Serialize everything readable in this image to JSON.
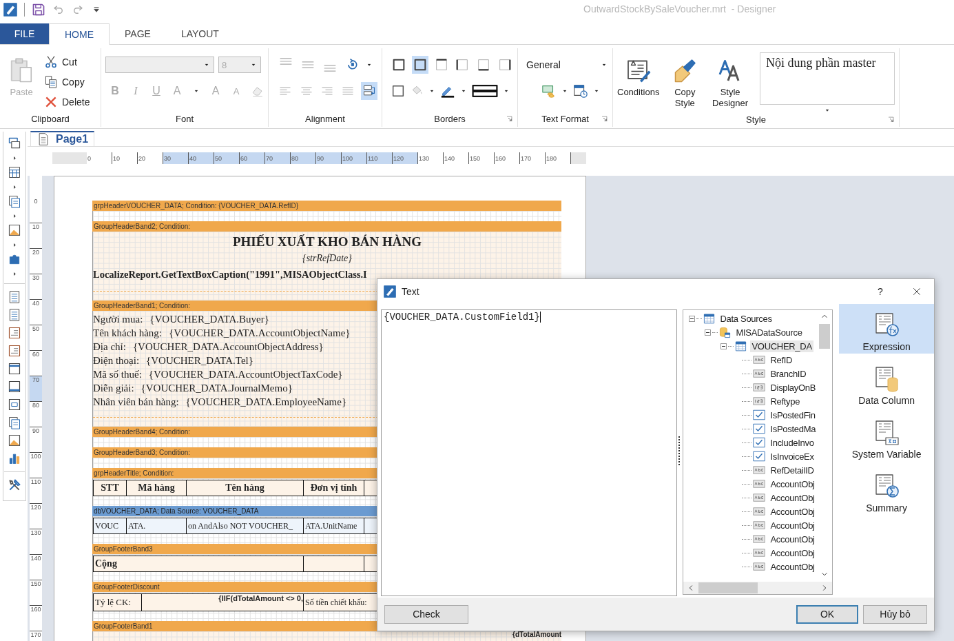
{
  "window": {
    "title": "OutwardStockBySaleVoucher.mrt  - Designer"
  },
  "ribbon": {
    "tabs": [
      {
        "label": "FILE",
        "kind": "file",
        "selected": false
      },
      {
        "label": "HOME",
        "kind": "tab",
        "selected": true
      },
      {
        "label": "PAGE",
        "kind": "tab",
        "selected": false
      },
      {
        "label": "LAYOUT",
        "kind": "tab",
        "selected": false
      }
    ],
    "clipboard": {
      "label": "Clipboard",
      "paste": {
        "label": "Paste",
        "disabled": true
      },
      "actions": [
        {
          "label": "Cut",
          "kind": "cut"
        },
        {
          "label": "Copy",
          "kind": "copy"
        },
        {
          "label": "Delete",
          "kind": "delete"
        }
      ]
    },
    "font": {
      "label": "Font",
      "disabled": true,
      "size": "8",
      "styles": [
        {
          "label": "B",
          "kind": "bold"
        },
        {
          "label": "I",
          "kind": "italic"
        },
        {
          "label": "U",
          "kind": "underline"
        },
        {
          "label": "A",
          "kind": "color"
        },
        {
          "label": "A",
          "kind": "grow"
        },
        {
          "label": "A",
          "kind": "shrink"
        }
      ]
    },
    "alignment": {
      "label": "Alignment",
      "buttons": [
        {
          "kind": "align-top",
          "on": false
        },
        {
          "kind": "align-middle",
          "on": false
        },
        {
          "kind": "align-bottom",
          "on": false
        },
        {
          "kind": "rotate",
          "on": false
        },
        {
          "kind": "align-left",
          "on": false
        },
        {
          "kind": "align-center",
          "on": false
        },
        {
          "kind": "align-right",
          "on": false
        },
        {
          "kind": "justify",
          "on": false
        },
        {
          "kind": "wrap",
          "on": true
        }
      ]
    },
    "borders": {
      "label": "Borders",
      "buttons": [
        {
          "kind": "border-all",
          "on": false
        },
        {
          "kind": "border-none",
          "on": true
        },
        {
          "kind": "border-top",
          "on": false
        },
        {
          "kind": "border-left",
          "on": false
        },
        {
          "kind": "border-bottom",
          "on": false
        },
        {
          "kind": "border-right",
          "on": false
        }
      ]
    },
    "text_format": {
      "label": "Text Format",
      "format": "General"
    },
    "style": {
      "label": "Style",
      "buttons": [
        {
          "label": "Conditions",
          "kind": "conditions"
        },
        {
          "label": "Copy Style",
          "kind": "copy-style"
        },
        {
          "label": "Style Designer",
          "kind": "style-designer"
        }
      ],
      "gallery": "Nội dung phần master"
    }
  },
  "document_tabs": [
    {
      "label": "Page1",
      "selected": true
    }
  ],
  "ruler": {
    "horizontal": [
      {
        "label": "0",
        "selected": false
      },
      {
        "label": "10",
        "selected": false
      },
      {
        "label": "20",
        "selected": false
      },
      {
        "label": "30",
        "selected": true
      },
      {
        "label": "40",
        "selected": true
      },
      {
        "label": "50",
        "selected": true
      },
      {
        "label": "60",
        "selected": true
      },
      {
        "label": "70",
        "selected": true
      },
      {
        "label": "80",
        "selected": true
      },
      {
        "label": "90",
        "selected": true
      },
      {
        "label": "100",
        "selected": true
      },
      {
        "label": "110",
        "selected": true
      },
      {
        "label": "120",
        "selected": true
      },
      {
        "label": "130",
        "selected": false
      },
      {
        "label": "140",
        "selected": false
      },
      {
        "label": "150",
        "selected": false
      },
      {
        "label": "160",
        "selected": false
      },
      {
        "label": "170",
        "selected": false
      },
      {
        "label": "180",
        "selected": false
      }
    ],
    "vertical": [
      {
        "label": "0",
        "selected": false
      },
      {
        "label": "10",
        "selected": false
      },
      {
        "label": "20",
        "selected": false
      },
      {
        "label": "30",
        "selected": false
      },
      {
        "label": "40",
        "selected": false
      },
      {
        "label": "50",
        "selected": false
      },
      {
        "label": "60",
        "selected": false
      },
      {
        "label": "70",
        "selected": true
      },
      {
        "label": "80",
        "selected": false
      },
      {
        "label": "90",
        "selected": false
      },
      {
        "label": "100",
        "selected": false
      },
      {
        "label": "110",
        "selected": false
      },
      {
        "label": "120",
        "selected": false
      },
      {
        "label": "130",
        "selected": false
      },
      {
        "label": "140",
        "selected": false
      },
      {
        "label": "150",
        "selected": false
      },
      {
        "label": "160",
        "selected": false
      },
      {
        "label": "170",
        "selected": false
      }
    ]
  },
  "report": {
    "bands": [
      {
        "caption": "grpHeaderVOUCHER_DATA; Condition: {VOUCHER_DATA.RefID}",
        "kind": "group",
        "content": {
          "kind": "empty"
        }
      },
      {
        "caption": "GroupHeaderBand2; Condition:",
        "kind": "group",
        "content": {
          "kind": "title",
          "title": "PHIẾU XUẤT KHO BÁN HÀNG",
          "subtitle": "{strRefDate}",
          "caption_line": "LocalizeReport.GetTextBoxCaption(\"1991\",MISAObjectClass.I"
        }
      },
      {
        "caption": "GroupHeaderBand1; Condition:",
        "kind": "group",
        "content": {
          "kind": "fields",
          "rows": [
            {
              "label": "Người mua:",
              "value": "{VOUCHER_DATA.Buyer}"
            },
            {
              "label": "Tên khách hàng:",
              "value": "{VOUCHER_DATA.AccountObjectName}"
            },
            {
              "label": "Địa chỉ:",
              "value": "{VOUCHER_DATA.AccountObjectAddress}"
            },
            {
              "label": "Điện thoại:",
              "value": "{VOUCHER_DATA.Tel}"
            },
            {
              "label": "Mã số thuế:",
              "value": "{VOUCHER_DATA.AccountObjectTaxCode}"
            },
            {
              "label": "Diễn giải:",
              "value": "{VOUCHER_DATA.JournalMemo}"
            },
            {
              "label": "Nhân viên bán hàng:",
              "value": "{VOUCHER_DATA.EmployeeName}"
            }
          ]
        }
      },
      {
        "caption": "GroupHeaderBand4; Condition:",
        "kind": "group",
        "content": {
          "kind": "empty"
        }
      },
      {
        "caption": "GroupHeaderBand3; Condition:",
        "kind": "group",
        "content": {
          "kind": "empty"
        }
      },
      {
        "caption": "grpHeaderTitle; Condition:",
        "kind": "group",
        "content": {
          "kind": "header",
          "cells": [
            "STT",
            "Mã hàng",
            "Tên hàng",
            "Đơn vị tính"
          ]
        }
      },
      {
        "caption": "dbVOUCHER_DATA; Data Source: VOUCHER_DATA",
        "kind": "data",
        "content": {
          "kind": "row",
          "cells": [
            "VOUC",
            "ATA.",
            "on AndAlso NOT VOUCHER_",
            "ATA.UnitName"
          ]
        }
      },
      {
        "caption": "GroupFooterBand3",
        "kind": "group",
        "content": {
          "kind": "total",
          "cells": [
            "Cộng"
          ]
        }
      },
      {
        "caption": "GroupFooterDiscount",
        "kind": "group",
        "content": {
          "kind": "discount",
          "cells": [
            "Tỷ lệ CK:",
            "{IIF(dTotalAmount <> 0,",
            "Số tiền chiết khấu:"
          ]
        }
      },
      {
        "caption": "GroupFooterBand1",
        "kind": "group",
        "content": {
          "kind": "footer",
          "cells": [
            "{dTotalAmount"
          ]
        }
      }
    ]
  },
  "dialog": {
    "title": "Text",
    "help": "?",
    "expression": "{VOUCHER_DATA.CustomField1}",
    "tree": {
      "items": [
        {
          "label": "Data Sources",
          "kind": "sources",
          "expanded": true,
          "selected": false,
          "children": [
            {
              "label": "MISADataSource",
              "kind": "database",
              "expanded": true,
              "selected": false,
              "children": [
                {
                  "label": "VOUCHER_DA",
                  "kind": "table",
                  "expanded": true,
                  "selected": true,
                  "children": [
                    {
                      "label": "RefID",
                      "kind": "text",
                      "selected": false
                    },
                    {
                      "label": "BranchID",
                      "kind": "text",
                      "selected": false
                    },
                    {
                      "label": "DisplayOnB",
                      "kind": "number",
                      "selected": false
                    },
                    {
                      "label": "Reftype",
                      "kind": "number",
                      "selected": false
                    },
                    {
                      "label": "IsPostedFin",
                      "kind": "bool",
                      "selected": false
                    },
                    {
                      "label": "IsPostedMa",
                      "kind": "bool",
                      "selected": false
                    },
                    {
                      "label": "IncludeInvo",
                      "kind": "bool",
                      "selected": false
                    },
                    {
                      "label": "IsInvoiceEx",
                      "kind": "bool",
                      "selected": false
                    },
                    {
                      "label": "RefDetailID",
                      "kind": "text",
                      "selected": false
                    },
                    {
                      "label": "AccountObj",
                      "kind": "text",
                      "selected": false
                    },
                    {
                      "label": "AccountObj",
                      "kind": "text",
                      "selected": false
                    },
                    {
                      "label": "AccountObj",
                      "kind": "text",
                      "selected": false
                    },
                    {
                      "label": "AccountObj",
                      "kind": "text",
                      "selected": false
                    },
                    {
                      "label": "AccountObj",
                      "kind": "text",
                      "selected": false
                    },
                    {
                      "label": "AccountObj",
                      "kind": "text",
                      "selected": false
                    },
                    {
                      "label": "AccountObj",
                      "kind": "text",
                      "selected": false
                    }
                  ]
                }
              ]
            }
          ]
        }
      ]
    },
    "insert_types": [
      {
        "label": "Expression",
        "kind": "expression",
        "selected": true
      },
      {
        "label": "Data Column",
        "kind": "column",
        "selected": false
      },
      {
        "label": "System Variable",
        "kind": "variable",
        "selected": false
      },
      {
        "label": "Summary",
        "kind": "summary",
        "selected": false
      }
    ],
    "buttons": [
      {
        "label": "Check",
        "kind": "check"
      },
      {
        "label": "OK",
        "kind": "ok"
      },
      {
        "label": "Hủy bỏ",
        "kind": "cancel"
      }
    ]
  }
}
